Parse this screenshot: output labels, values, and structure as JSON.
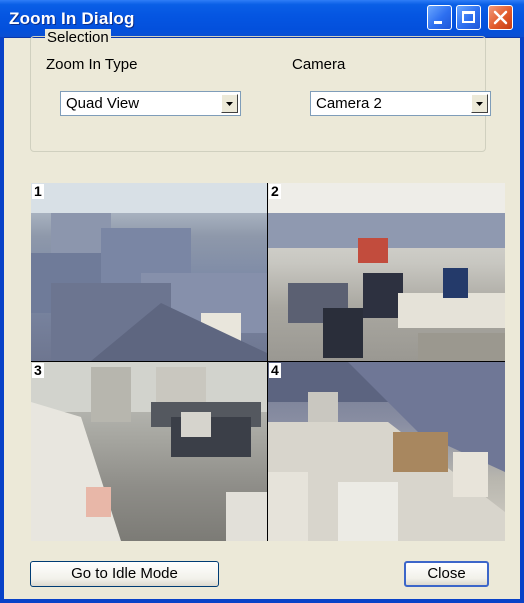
{
  "window": {
    "title": "Zoom In Dialog",
    "colors": {
      "titlebar": "#0556e2",
      "client": "#ece9d8",
      "close_button": "#e25b2b"
    }
  },
  "titlebar_buttons": {
    "minimize_icon": "minimize-icon",
    "maximize_icon": "maximize-icon",
    "close_icon": "close-icon"
  },
  "selection": {
    "legend": "Selection",
    "zoom_type_label": "Zoom In Type",
    "zoom_type_value": "Quad View",
    "camera_label": "Camera",
    "camera_value": "Camera 2"
  },
  "quad_view": {
    "panels": [
      {
        "number": "1"
      },
      {
        "number": "2"
      },
      {
        "number": "3"
      },
      {
        "number": "4"
      }
    ]
  },
  "buttons": {
    "idle_mode_label": "Go to Idle Mode",
    "close_label": "Close"
  }
}
